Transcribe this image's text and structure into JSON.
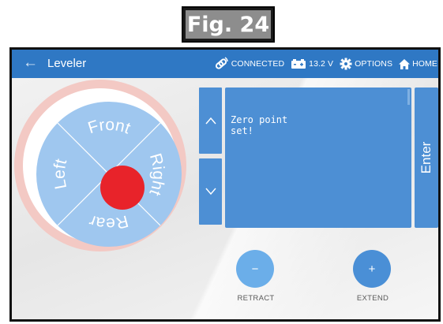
{
  "figure": {
    "caption": "Fig. 24"
  },
  "appbar": {
    "back_icon": "arrow-left-icon",
    "title": "Leveler",
    "connection_status": "CONNECTED",
    "battery_voltage": "13.2 V",
    "options_label": "OPTIONS",
    "home_label": "HOME"
  },
  "dial": {
    "front_label": "Front",
    "rear_label": "Rear",
    "left_label": "Left",
    "right_label": "Right",
    "center_color": "#e8232a"
  },
  "controls": {
    "up_glyph": "^",
    "down_glyph": "v",
    "display_text": "Zero point\nset!",
    "enter_label": "Enter",
    "retract_glyph": "−",
    "retract_label": "RETRACT",
    "extend_glyph": "+",
    "extend_label": "EXTEND"
  },
  "colors": {
    "appbar": "#2f78c4",
    "panel_blue": "#4d8fd4",
    "dial_blue": "#9fc7ef",
    "dial_ring": "#f3c9c4"
  }
}
